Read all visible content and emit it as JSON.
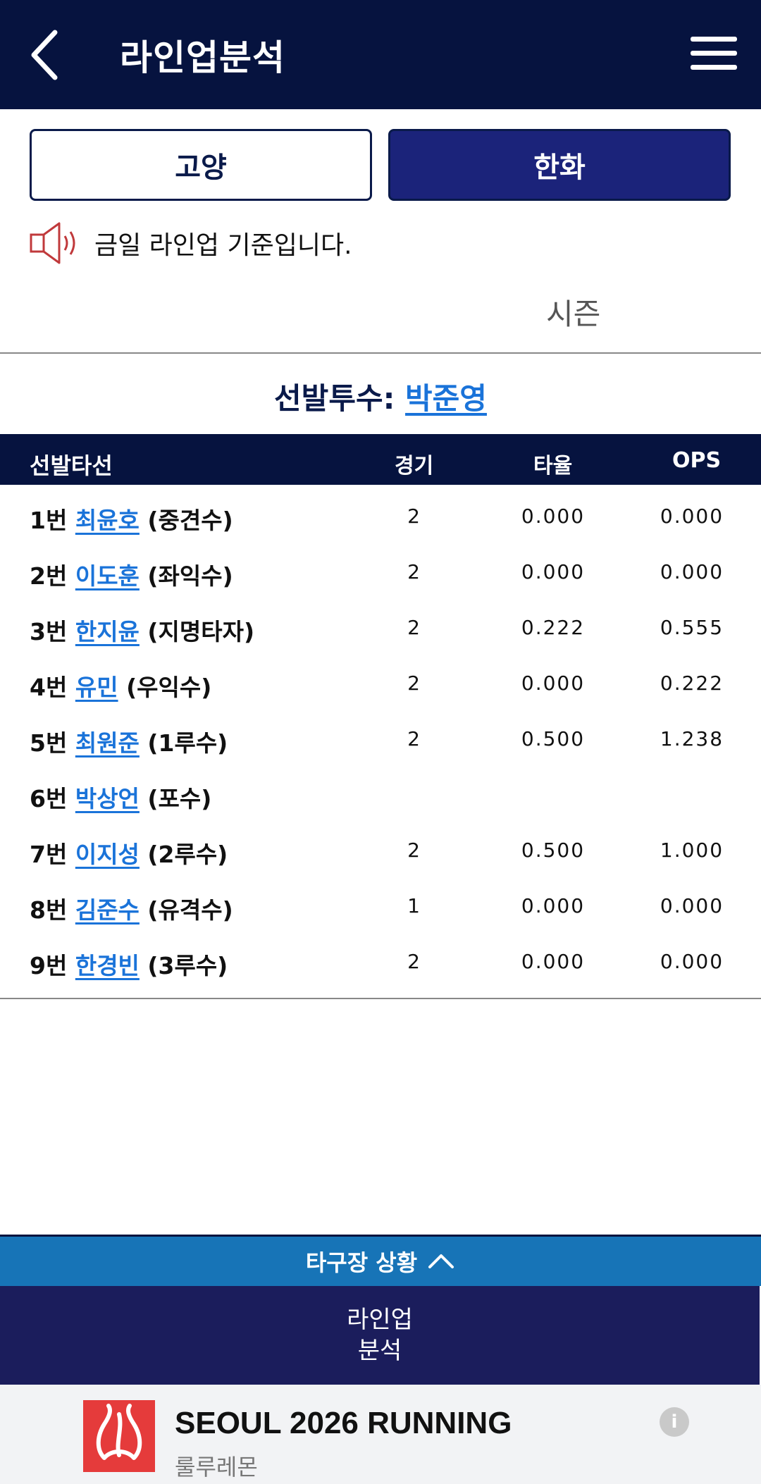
{
  "header": {
    "title": "라인업분석",
    "back_icon": "chevron-left-icon",
    "menu_icon": "hamburger-menu-icon"
  },
  "teams": {
    "left": "고양",
    "right": "한화",
    "selected": "한화"
  },
  "notice": {
    "text": "금일 라인업 기준입니다.",
    "icon": "speaker-icon"
  },
  "season_label": "시즌",
  "pitcher": {
    "label": "선발투수:",
    "name": "박준영"
  },
  "table": {
    "headers": [
      "선발타선",
      "경기",
      "타율",
      "OPS"
    ],
    "rows": [
      {
        "order": "1번",
        "name": "최윤호",
        "pos": "(중견수)",
        "g": "2",
        "avg": "0.000",
        "ops": "0.000"
      },
      {
        "order": "2번",
        "name": "이도훈",
        "pos": "(좌익수)",
        "g": "2",
        "avg": "0.000",
        "ops": "0.000"
      },
      {
        "order": "3번",
        "name": "한지윤",
        "pos": "(지명타자)",
        "g": "2",
        "avg": "0.222",
        "ops": "0.555"
      },
      {
        "order": "4번",
        "name": "유민",
        "pos": "(우익수)",
        "g": "2",
        "avg": "0.000",
        "ops": "0.222"
      },
      {
        "order": "5번",
        "name": "최원준",
        "pos": "(1루수)",
        "g": "2",
        "avg": "0.500",
        "ops": "1.238"
      },
      {
        "order": "6번",
        "name": "박상언",
        "pos": "(포수)",
        "g": "",
        "avg": "",
        "ops": ""
      },
      {
        "order": "7번",
        "name": "이지성",
        "pos": "(2루수)",
        "g": "2",
        "avg": "0.500",
        "ops": "1.000"
      },
      {
        "order": "8번",
        "name": "김준수",
        "pos": "(유격수)",
        "g": "1",
        "avg": "0.000",
        "ops": "0.000"
      },
      {
        "order": "9번",
        "name": "한경빈",
        "pos": "(3루수)",
        "g": "2",
        "avg": "0.000",
        "ops": "0.000"
      }
    ]
  },
  "bottom": {
    "stadium_label": "타구장 상황",
    "lineup_line1": "라인업",
    "lineup_line2": "분석"
  },
  "ad": {
    "title": "SEOUL 2026 RUNNING",
    "subtitle": "룰루레몬",
    "info": "i"
  },
  "colors": {
    "header_bg": "#06133f",
    "accent_link": "#1a73d9",
    "stadium_bar": "#1774b7",
    "selected_team": "#1b237a",
    "ad_logo": "#e53b3b"
  }
}
